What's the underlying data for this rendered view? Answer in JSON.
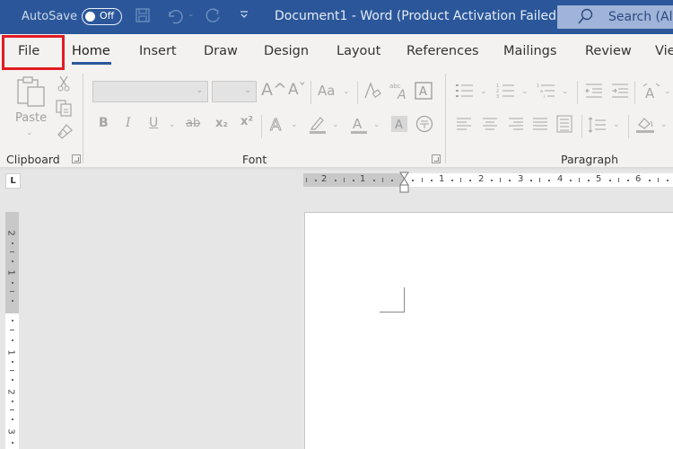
{
  "titlebar": {
    "autosave_label": "AutoSave",
    "autosave_state": "Off",
    "document_title": "Document1  -  Word (Product Activation Failed)",
    "search_placeholder": "Search (Alt+Q)",
    "icons": [
      "save-icon",
      "undo-icon",
      "redo-icon",
      "customize-qat-icon"
    ]
  },
  "tabs": [
    {
      "label": "File",
      "highlighted": true
    },
    {
      "label": "Home",
      "active": true
    },
    {
      "label": "Insert"
    },
    {
      "label": "Draw"
    },
    {
      "label": "Design"
    },
    {
      "label": "Layout"
    },
    {
      "label": "References"
    },
    {
      "label": "Mailings"
    },
    {
      "label": "Review"
    },
    {
      "label": "View"
    }
  ],
  "ribbon": {
    "clipboard": {
      "label": "Clipboard",
      "paste_label": "Paste",
      "icons": [
        "paste-icon",
        "cut-icon",
        "copy-icon",
        "format-painter-icon"
      ]
    },
    "font": {
      "label": "Font",
      "font_name_value": "",
      "font_size_value": "",
      "grow_font": "A^",
      "shrink_font": "Aˇ",
      "change_case": "Aa",
      "bold": "B",
      "italic": "I",
      "underline": "U",
      "strikethrough": "ab",
      "subscript": "x₂",
      "superscript": "x²"
    },
    "paragraph": {
      "label": "Paragraph"
    }
  },
  "ruler": {
    "tab_selector": "L",
    "horizontal_marks_left": [
      "2",
      "1"
    ],
    "horizontal_marks_right": [
      "1",
      "2",
      "3",
      "4",
      "5",
      "6"
    ],
    "vertical_marks_top": [
      "2",
      "1"
    ],
    "vertical_marks_bottom": [
      "1",
      "2",
      "3"
    ]
  },
  "colors": {
    "title_bar": "#2b579a",
    "highlight_border": "#e31b23",
    "ribbon_bg": "#f3f2f1"
  }
}
